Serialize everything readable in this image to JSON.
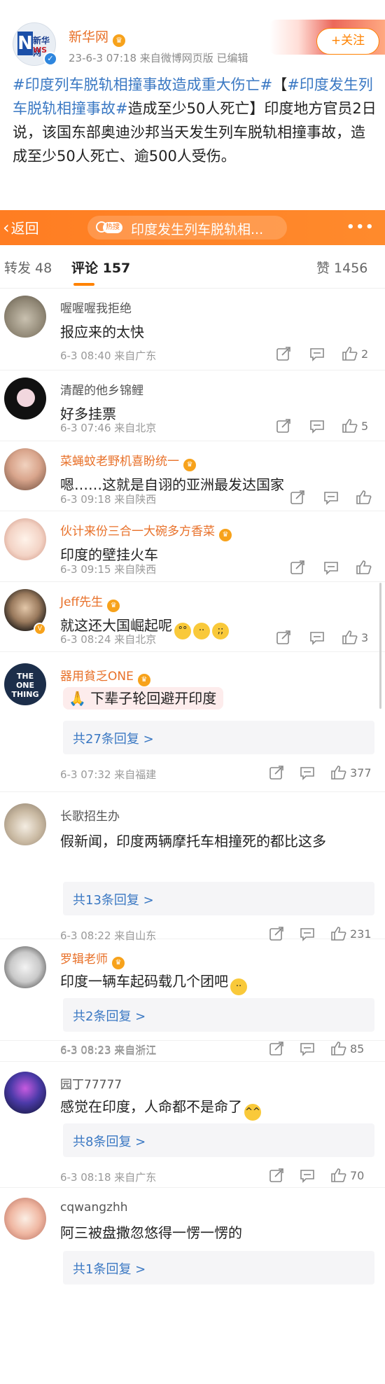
{
  "post": {
    "author": "新华网",
    "meta": "23-6-3 07:18  来自微博网页版  已编辑",
    "follow_label": "+关注",
    "hashtag1": "#印度列车脱轨相撞事故造成重大伤亡#",
    "text1": "【",
    "hashtag2": "#印度发生列车脱轨相撞事故#",
    "text2": "造成至少50人死亡】印度地方官员2日说，该国东部奥迪沙邦当天发生列车脱轨相撞事故，造成至少50人死亡、逾500人受伤。",
    "avatar_logo": {
      "n": "N",
      "cn": "新华网",
      "ws": "WS"
    }
  },
  "titlebar": {
    "back_label": "返回",
    "hot_tag": "热搜",
    "title": "印度发生列车脱轨相...",
    "more_label": "•••"
  },
  "tabs": {
    "reposts": "转发 48",
    "comments": "评论 157",
    "likes": "赞 1456"
  },
  "comments": [
    {
      "name": "喔喔喔我拒绝",
      "text": "报应来的太快",
      "meta": "6-3 08:40  来自广东",
      "likes": "2",
      "vip": false,
      "replies": ""
    },
    {
      "name": "清醒的他乡锦鲤",
      "text": "好多挂票",
      "meta": "6-3 07:46  来自北京",
      "likes": "5",
      "vip": false,
      "replies": ""
    },
    {
      "name": "菜蝇蚊老野机喜盼统一",
      "text": "嗯……这就是自诩的亚洲最发达国家",
      "meta": "6-3 09:18  来自陕西",
      "likes": "",
      "vip": true,
      "replies": ""
    },
    {
      "name": "伙计来份三合一大碗多方香菜",
      "text": "印度的壁挂火车",
      "meta": "6-3 09:15  来自陕西",
      "likes": "",
      "vip": true,
      "replies": ""
    },
    {
      "name": "Jeff先生",
      "text": "就这还大国崛起呢",
      "meta": "6-3 08:24  来自北京",
      "likes": "3",
      "vip": true,
      "replies": ""
    },
    {
      "name": "器用貧乏ONE",
      "text": "下辈子轮回避开印度",
      "meta": "6-3 07:32  来自福建",
      "likes": "377",
      "vip": true,
      "replies": "共27条回复 >"
    },
    {
      "name": "长歌招生办",
      "text": "假新闻，印度两辆摩托车相撞死的都比这多",
      "meta": "6-3 08:22  来自山东",
      "likes": "231",
      "vip": false,
      "replies": "共13条回复 >"
    },
    {
      "name": "罗辑老师",
      "text": "印度一辆车起码载几个团吧",
      "meta": "6-3 08:23  来自浙江",
      "likes": "85",
      "vip": true,
      "replies": "共2条回复 >"
    },
    {
      "name": "园丁77777",
      "text": "感觉在印度，人命都不是命了",
      "meta": "6-3 08:18  来自广东",
      "likes": "70",
      "vip": false,
      "replies": "共8条回复 >"
    },
    {
      "name": "cqwangzhh",
      "text": "阿三被盘撒忽悠得一愣一愣的",
      "meta": "",
      "likes": "",
      "vip": false,
      "replies": "共1条回复 >"
    }
  ],
  "avatar_text": {
    "one_thing": "THE ONE THING"
  },
  "colors": {
    "accent": "#ff8200",
    "link": "#3a78c3",
    "vip_name": "#e8712a",
    "titlebar": "#ff7d22"
  }
}
